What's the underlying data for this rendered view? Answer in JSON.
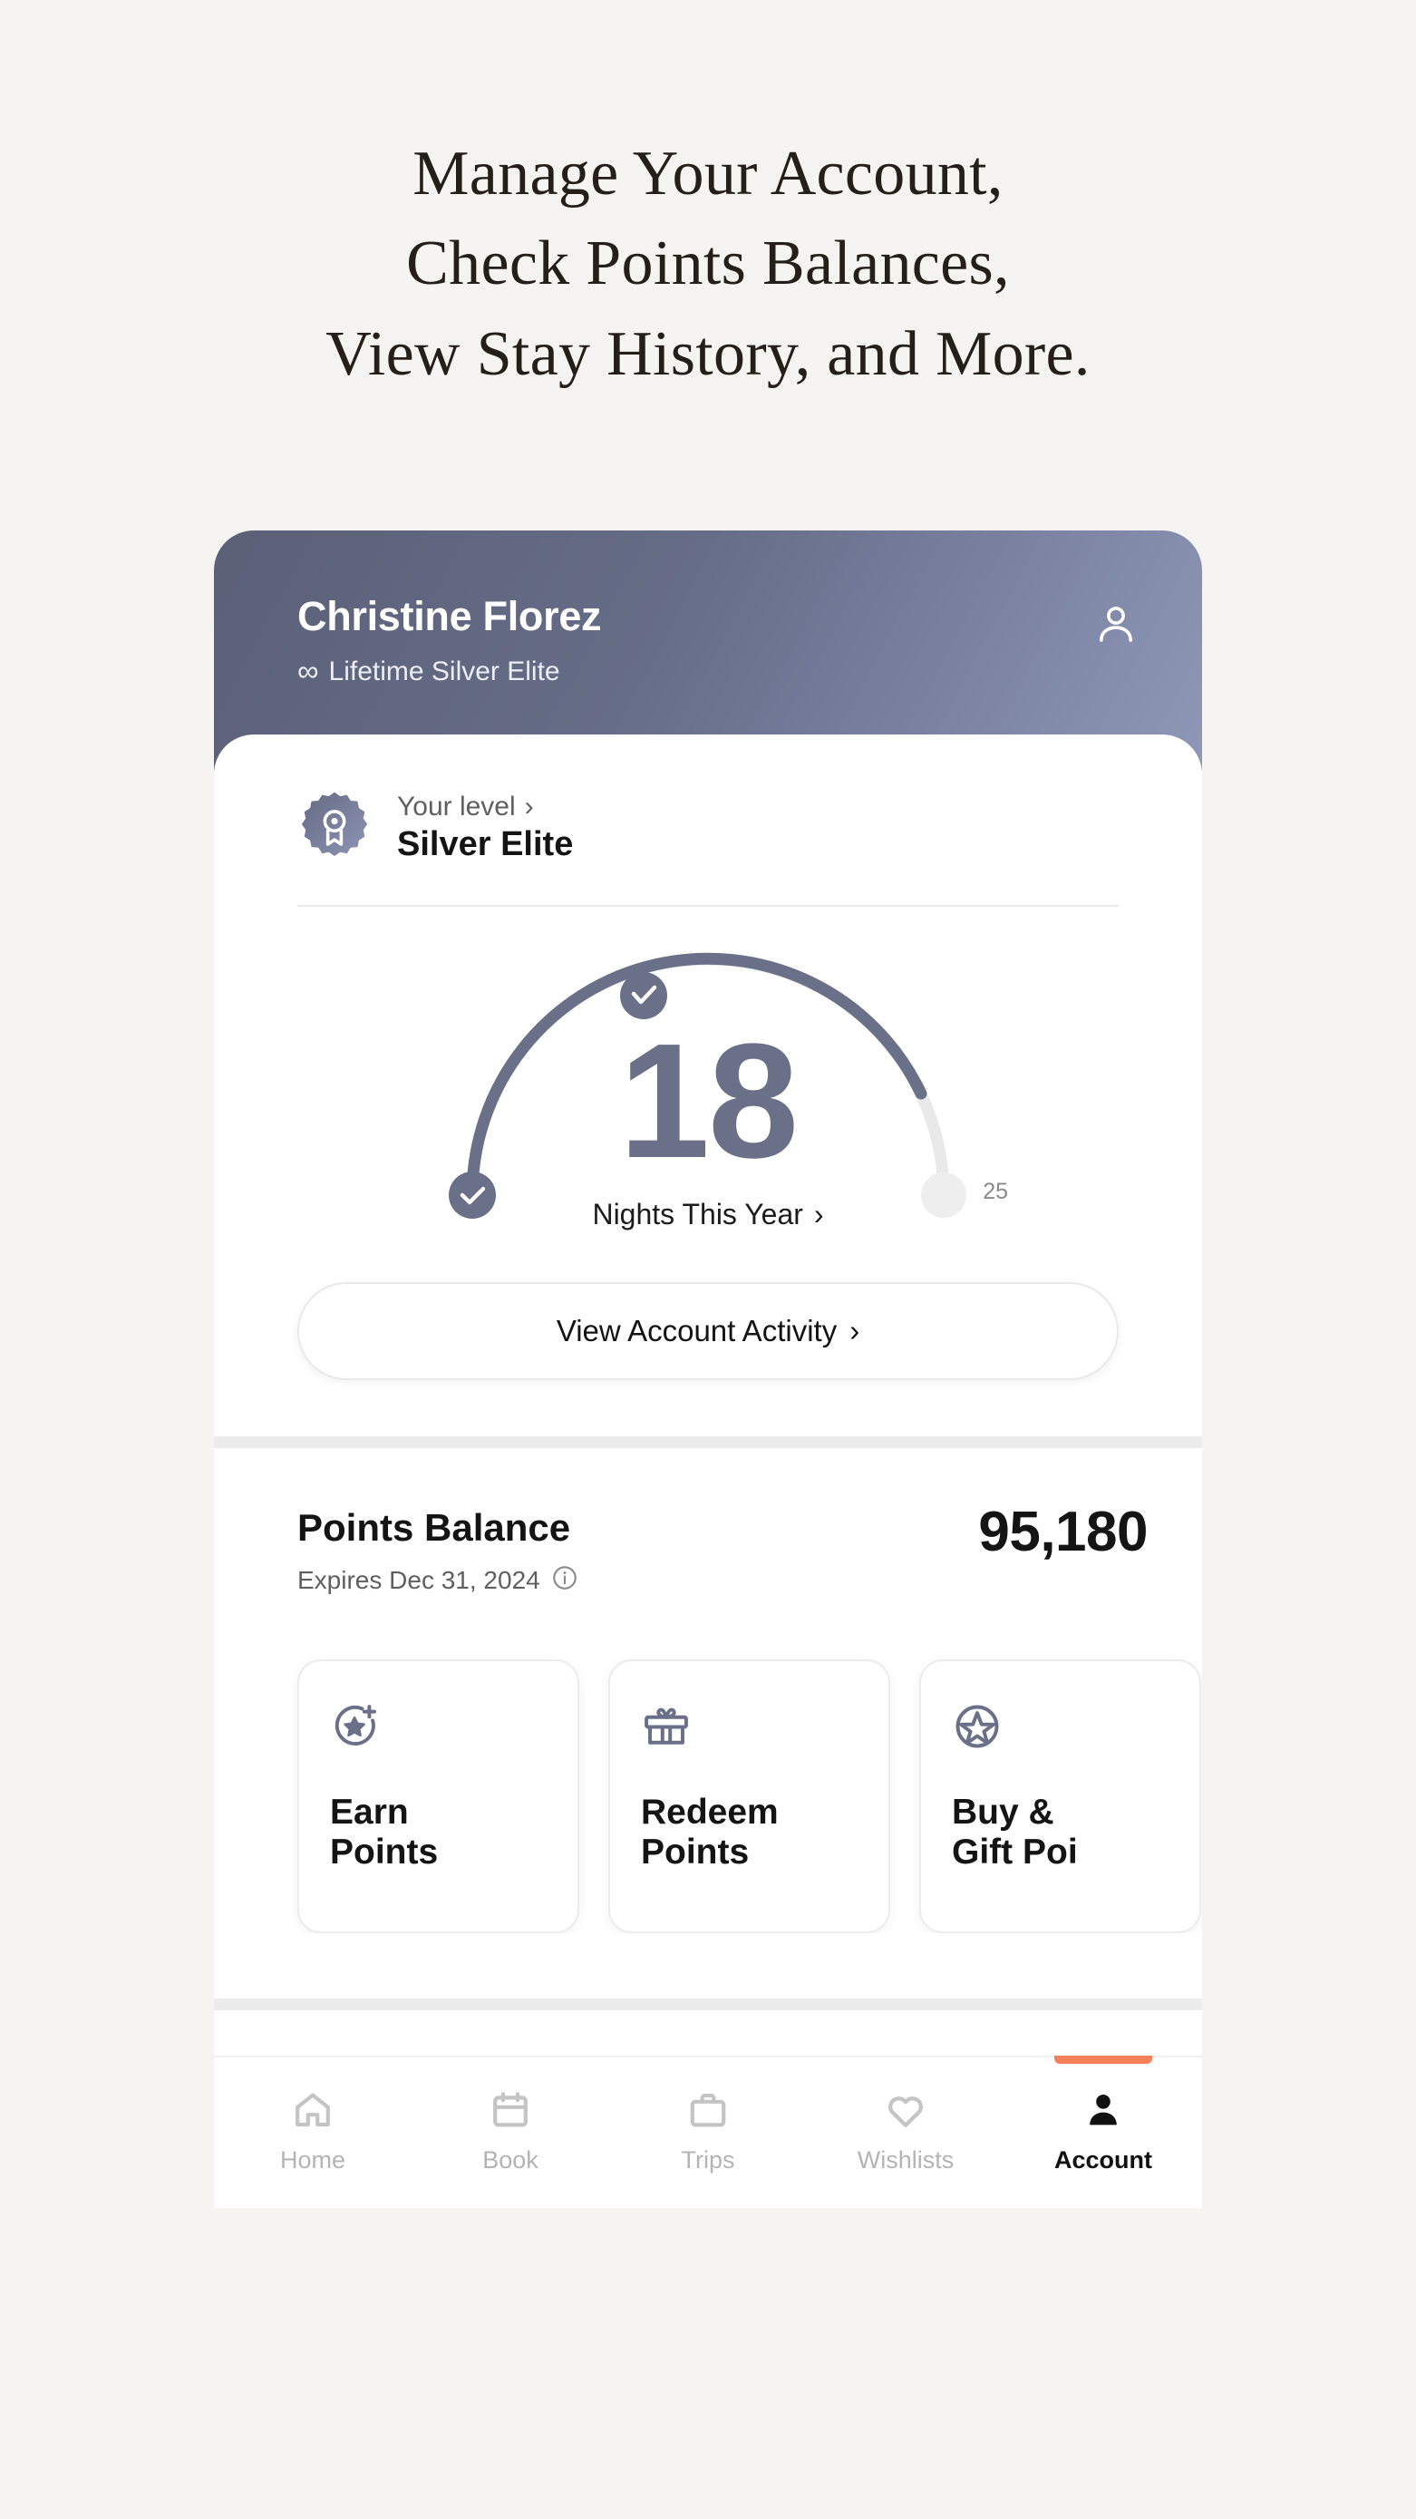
{
  "headline": {
    "lines": [
      "Manage Your Account,",
      "Check Points Balances,",
      "View Stay History, and More."
    ]
  },
  "hero": {
    "name": "Christine Florez",
    "status_glyph": "∞",
    "status": "Lifetime Silver Elite",
    "profile_icon": "person-outline-icon"
  },
  "level": {
    "eyebrow": "Your level",
    "chevron": "›",
    "title": "Silver Elite",
    "badge_icon": "award-rosette-icon"
  },
  "gauge": {
    "value": "18",
    "label": "Nights This Year",
    "chevron": "›",
    "max": "25",
    "start_marker_icon": "check-circle-icon",
    "progress_marker_icon": "check-circle-icon",
    "progress_color": "#6b7089",
    "track_color": "#e9e9e9"
  },
  "activity_button": {
    "label": "View Account Activity",
    "chevron": "›"
  },
  "points": {
    "title": "Points Balance",
    "value": "95,180",
    "expiry": "Expires Dec 31, 2024",
    "info_icon": "info-circle-icon",
    "tiles": [
      {
        "label_line1": "Earn",
        "label_line2": "Points",
        "icon": "star-plus-circle-icon"
      },
      {
        "label_line1": "Redeem",
        "label_line2": "Points",
        "icon": "gift-box-icon"
      },
      {
        "label_line1": "Buy &",
        "label_line2": "Gift Poi",
        "icon": "star-circle-icon"
      }
    ]
  },
  "nav": {
    "active_color": "#f4805a",
    "items": [
      {
        "label": "Home",
        "icon": "home-icon",
        "active": false
      },
      {
        "label": "Book",
        "icon": "calendar-icon",
        "active": false
      },
      {
        "label": "Trips",
        "icon": "briefcase-icon",
        "active": false
      },
      {
        "label": "Wishlists",
        "icon": "heart-icon",
        "active": false
      },
      {
        "label": "Account",
        "icon": "person-icon",
        "active": true
      }
    ]
  }
}
